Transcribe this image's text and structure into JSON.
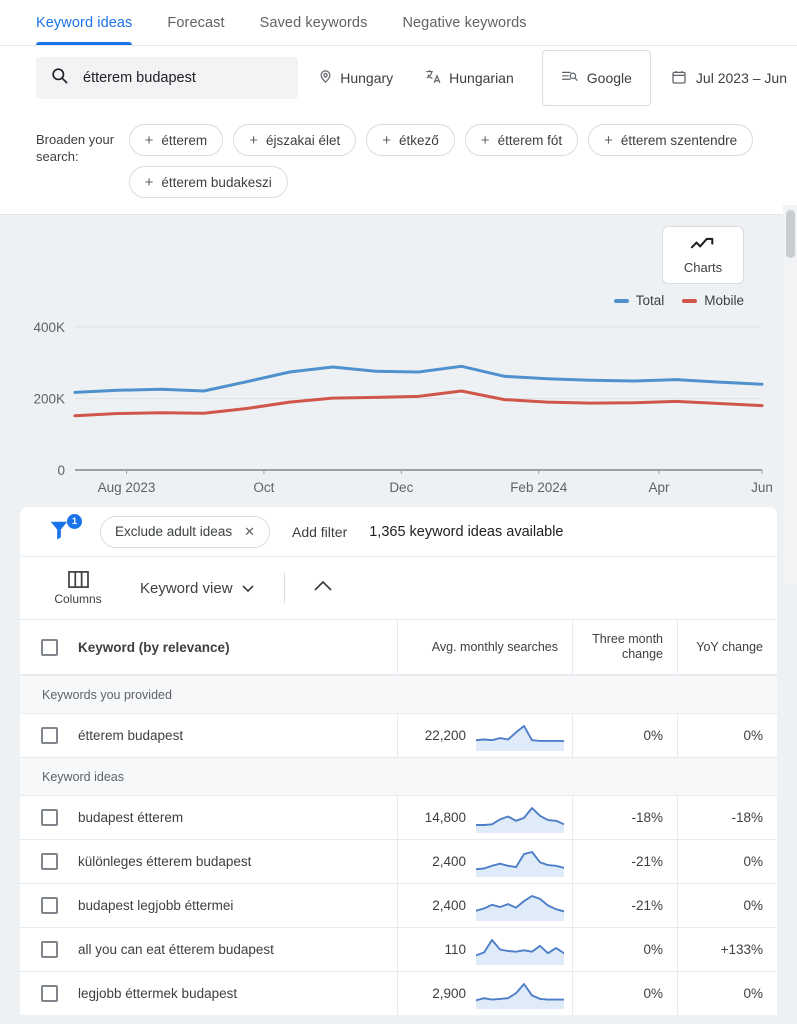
{
  "tabs": [
    {
      "label": "Keyword ideas",
      "active": true
    },
    {
      "label": "Forecast",
      "active": false
    },
    {
      "label": "Saved keywords",
      "active": false
    },
    {
      "label": "Negative keywords",
      "active": false
    }
  ],
  "search": {
    "value": "étterem budapest",
    "placeholder": "Enter a keyword",
    "location": "Hungary",
    "language": "Hungarian",
    "network": "Google",
    "date_range": "Jul 2023 – Jun"
  },
  "broaden": {
    "label": "Broaden your search:",
    "chips": [
      "étterem",
      "éjszakai élet",
      "étkező",
      "étterem fót",
      "étterem szentendre",
      "étterem budakeszi"
    ]
  },
  "charts_button": {
    "label": "Charts",
    "icon": "line-chart-icon"
  },
  "legend": [
    {
      "label": "Total",
      "color": "#4f91cd"
    },
    {
      "label": "Mobile",
      "color": "#d0554a"
    }
  ],
  "filters": {
    "badge_count": "1",
    "chip_label": "Exclude adult ideas",
    "add_filter": "Add filter",
    "available": "1,365 keyword ideas available"
  },
  "toolbar": {
    "columns_label": "Columns",
    "view_label": "Keyword view"
  },
  "table": {
    "headers": {
      "keyword": "Keyword (by relevance)",
      "avg": "Avg. monthly searches",
      "three_month": "Three month change",
      "yoy": "YoY change"
    },
    "sections": [
      {
        "title": "Keywords you provided",
        "rows": [
          {
            "keyword": "étterem budapest",
            "avg": "22,200",
            "three_month": "0%",
            "yoy": "0%",
            "spark": [
              22,
              24,
              22,
              28,
              24,
              44,
              62,
              22,
              20,
              20,
              20,
              20
            ]
          }
        ]
      },
      {
        "title": "Keyword ideas",
        "rows": [
          {
            "keyword": "budapest étterem",
            "avg": "14,800",
            "three_month": "-18%",
            "yoy": "-18%",
            "spark": [
              14,
              14,
              16,
              30,
              38,
              26,
              34,
              62,
              40,
              28,
              26,
              16
            ]
          },
          {
            "keyword": "különleges étterem budapest",
            "avg": "2,400",
            "three_month": "-21%",
            "yoy": "0%",
            "spark": [
              14,
              16,
              24,
              30,
              24,
              20,
              58,
              64,
              34,
              26,
              24,
              18
            ]
          },
          {
            "keyword": "budapest legjobb éttermei",
            "avg": "2,400",
            "three_month": "-21%",
            "yoy": "0%",
            "spark": [
              20,
              26,
              36,
              30,
              38,
              28,
              46,
              60,
              52,
              34,
              24,
              18
            ]
          },
          {
            "keyword": "all you can eat étterem budapest",
            "avg": "110",
            "three_month": "0%",
            "yoy": "+133%",
            "spark": [
              18,
              26,
              60,
              34,
              30,
              28,
              32,
              28,
              44,
              24,
              38,
              24
            ]
          },
          {
            "keyword": "legjobb éttermek budapest",
            "avg": "2,900",
            "three_month": "0%",
            "yoy": "0%",
            "spark": [
              16,
              22,
              18,
              20,
              22,
              36,
              62,
              30,
              20,
              18,
              18,
              18
            ]
          }
        ]
      }
    ]
  },
  "chart_data": {
    "type": "line",
    "title": "",
    "xlabel": "",
    "ylabel": "",
    "ylim": [
      0,
      400000
    ],
    "yticks": [
      0,
      200000,
      400000
    ],
    "ytick_labels": [
      "0",
      "200K",
      "400K"
    ],
    "grid": true,
    "legend_position": "top-right",
    "x": [
      "Jul 2023",
      "Aug 2023",
      "Sep 2023",
      "Oct 2023",
      "Nov 2023",
      "Dec 2023",
      "Jan 2024",
      "Feb 2024",
      "Mar 2024",
      "Apr 2024",
      "May 2024",
      "Jun 2024"
    ],
    "xtick_labels": [
      "Aug 2023",
      "Oct",
      "Dec",
      "Feb 2024",
      "Apr",
      "Jun"
    ],
    "series": [
      {
        "name": "Total",
        "color": "#4f91cd",
        "values": [
          217000,
          223000,
          226000,
          221000,
          247000,
          274000,
          288000,
          276000,
          274000,
          290000,
          262000,
          255000,
          251000,
          249000,
          253000,
          246000,
          240000
        ]
      },
      {
        "name": "Mobile",
        "color": "#d0554a",
        "values": [
          152000,
          158000,
          160000,
          159000,
          172000,
          190000,
          201000,
          203000,
          206000,
          221000,
          197000,
          190000,
          187000,
          188000,
          192000,
          186000,
          180000
        ]
      }
    ]
  }
}
